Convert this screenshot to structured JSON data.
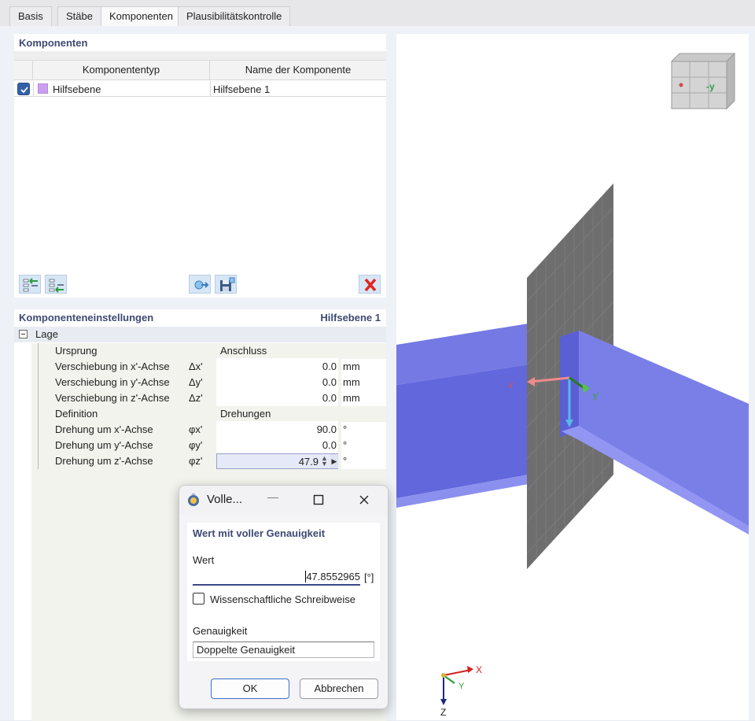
{
  "tabs": [
    "Basis",
    "Stäbe",
    "Komponenten",
    "Plausibilitätskontrolle"
  ],
  "active_tab": "Komponenten",
  "components_panel": {
    "title": "Komponenten",
    "columns": [
      "Komponententyp",
      "Name der Komponente"
    ],
    "rows": [
      {
        "checked": true,
        "color": "#cc9ff1",
        "type": "Hilfsebene",
        "name": "Hilfsebene 1"
      }
    ],
    "toolbar_icons": [
      "insert-component-icon",
      "insert-below-icon",
      "export-icon",
      "save-icon",
      "delete-icon"
    ]
  },
  "settings_panel": {
    "title": "Komponenteneinstellungen",
    "selected": "Hilfsebene 1",
    "group": "Lage",
    "rows": [
      {
        "name": "Ursprung",
        "symbol": "",
        "value": "Anschluss",
        "unit": ""
      },
      {
        "name": "Verschiebung in x'-Achse",
        "symbol": "Δx'",
        "value": "0.0",
        "unit": "mm"
      },
      {
        "name": "Verschiebung in y'-Achse",
        "symbol": "Δy'",
        "value": "0.0",
        "unit": "mm"
      },
      {
        "name": "Verschiebung in z'-Achse",
        "symbol": "Δz'",
        "value": "0.0",
        "unit": "mm"
      },
      {
        "name": "Definition",
        "symbol": "",
        "value": "Drehungen",
        "unit": ""
      },
      {
        "name": "Drehung um x'-Achse",
        "symbol": "φx'",
        "value": "90.0",
        "unit": "°"
      },
      {
        "name": "Drehung um y'-Achse",
        "symbol": "φy'",
        "value": "0.0",
        "unit": "°"
      },
      {
        "name": "Drehung um z'-Achse",
        "symbol": "φz'",
        "value": "47.9",
        "unit": "°"
      }
    ]
  },
  "view3d": {
    "nav_cube_label": "-y",
    "axis_labels": {
      "x_local": "x'",
      "y_local": "y'",
      "x": "X",
      "y": "Y",
      "z": "Z"
    }
  },
  "dialog": {
    "title": "Volle...",
    "heading": "Wert mit voller Genauigkeit",
    "value_label": "Wert",
    "value": "47.8552965",
    "unit": "[°]",
    "scientific_label": "Wissenschaftliche Schreibweise",
    "scientific_checked": false,
    "precision_label": "Genauigkeit",
    "precision_value": "Doppelte Genauigkeit",
    "ok": "OK",
    "cancel": "Abbrechen"
  }
}
